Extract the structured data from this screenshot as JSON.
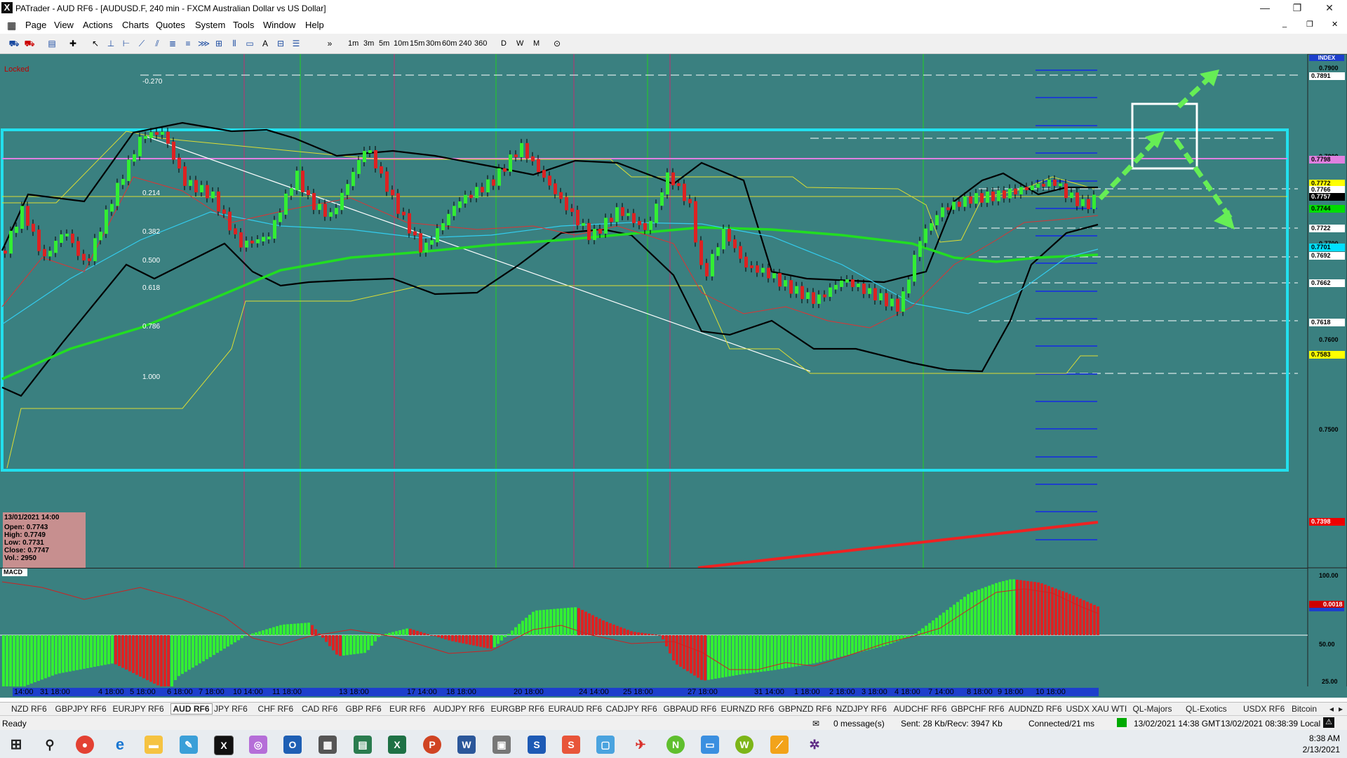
{
  "window": {
    "title": "PATrader - AUD RF6 - [AUDUSD.F, 240 min - FXCM Australian Dollar vs US Dollar]",
    "app_letter": "X"
  },
  "menu": [
    "Page",
    "View",
    "Actions",
    "Charts",
    "Quotes",
    "System",
    "Tools",
    "Window",
    "Help"
  ],
  "timeframes": [
    "1m",
    "3m",
    "5m",
    "10m",
    "15m",
    "30m",
    "60m",
    "240",
    "360",
    "D",
    "W",
    "M"
  ],
  "chart": {
    "locked_label": "Locked",
    "index_label": "INDEX",
    "fib_labels": [
      "-0.270",
      "0.214",
      "0.382",
      "0.500",
      "0.618",
      "0.786",
      "1.000"
    ],
    "price_ticks": [
      "0.7900",
      "0.7800",
      "0.7700",
      "0.7600",
      "0.7500"
    ],
    "price_labels": [
      {
        "text": "0.7891",
        "bg": "#ffffff",
        "fg": "#000000"
      },
      {
        "text": "0.7798",
        "bg": "#e080e0",
        "fg": "#000000"
      },
      {
        "text": "0.7772",
        "bg": "#ffff00",
        "fg": "#000000"
      },
      {
        "text": "0.7766",
        "bg": "#ffffff",
        "fg": "#000000"
      },
      {
        "text": "0.7757",
        "bg": "#000000",
        "fg": "#ffffff"
      },
      {
        "text": "0.7744",
        "bg": "#00dd00",
        "fg": "#000000"
      },
      {
        "text": "0.7722",
        "bg": "#ffffff",
        "fg": "#000000"
      },
      {
        "text": "0.7701",
        "bg": "#00e0ff",
        "fg": "#000000"
      },
      {
        "text": "0.7692",
        "bg": "#ffffff",
        "fg": "#000000"
      },
      {
        "text": "0.7662",
        "bg": "#ffffff",
        "fg": "#000000"
      },
      {
        "text": "0.7618",
        "bg": "#ffffff",
        "fg": "#000000"
      },
      {
        "text": "0.7583",
        "bg": "#ffff00",
        "fg": "#000000"
      },
      {
        "text": "0.7398",
        "bg": "#ee0000",
        "fg": "#ffffff"
      }
    ],
    "ohlc": {
      "date": "13/01/2021 14:00",
      "open": "Open: 0.7743",
      "high": "High: 0.7749",
      "low": "Low: 0.7731",
      "close": "Close: 0.7747",
      "vol": "Vol.: 2950"
    },
    "indicator_label": "MACD",
    "macd_ticks": [
      "100.00",
      "50.00",
      "25.00"
    ],
    "macd_value_label": "0.0018",
    "time_labels": [
      "14:00",
      "31 18:00",
      "4 18:00",
      "5 18:00",
      "6 18:00",
      "7 18:00",
      "10 14:00",
      "11 18:00",
      "13 18:00",
      "17 14:00",
      "18 18:00",
      "20 18:00",
      "24 14:00",
      "25 18:00",
      "27 18:00",
      "31 14:00",
      "1 18:00",
      "2 18:00",
      "3 18:00",
      "4 18:00",
      "7 14:00",
      "8 18:00",
      "9 18:00",
      "10 18:00"
    ],
    "colors": {
      "background": "#3a8080",
      "bull": "#33ee33",
      "bear": "#dd2222",
      "box": "#22e0ee",
      "arrow": "#66ee55"
    }
  },
  "tabs": [
    "NZD RF6",
    "GBPJPY RF6",
    "EURJPY RF6",
    "AUD RF6",
    "JPY RF6",
    "CHF RF6",
    "CAD RF6",
    "GBP RF6",
    "EUR RF6",
    "AUDJPY RF6",
    "EURGBP RF6",
    "EURAUD RF6",
    "CADJPY RF6",
    "GBPAUD RF6",
    "EURNZD RF6",
    "GBPNZD RF6",
    "NZDJPY RF6",
    "AUDCHF RF6",
    "GBPCHF RF6",
    "AUDNZD RF6",
    "USDX XAU WTI",
    "QL-Majors",
    "QL-Exotics",
    "USDX RF6",
    "Bitcoin"
  ],
  "active_tab": "AUD RF6",
  "status": {
    "ready": "Ready",
    "messages": "0 message(s)",
    "traffic": "Sent: 28 Kb/Recv: 3947 Kb",
    "connection": "Connected/21 ms",
    "gmt": "13/02/2021 14:38 GMT",
    "local": "13/02/2021 08:38:39 Local"
  },
  "taskbar": {
    "time": "8:38 AM",
    "date": "2/13/2021"
  }
}
